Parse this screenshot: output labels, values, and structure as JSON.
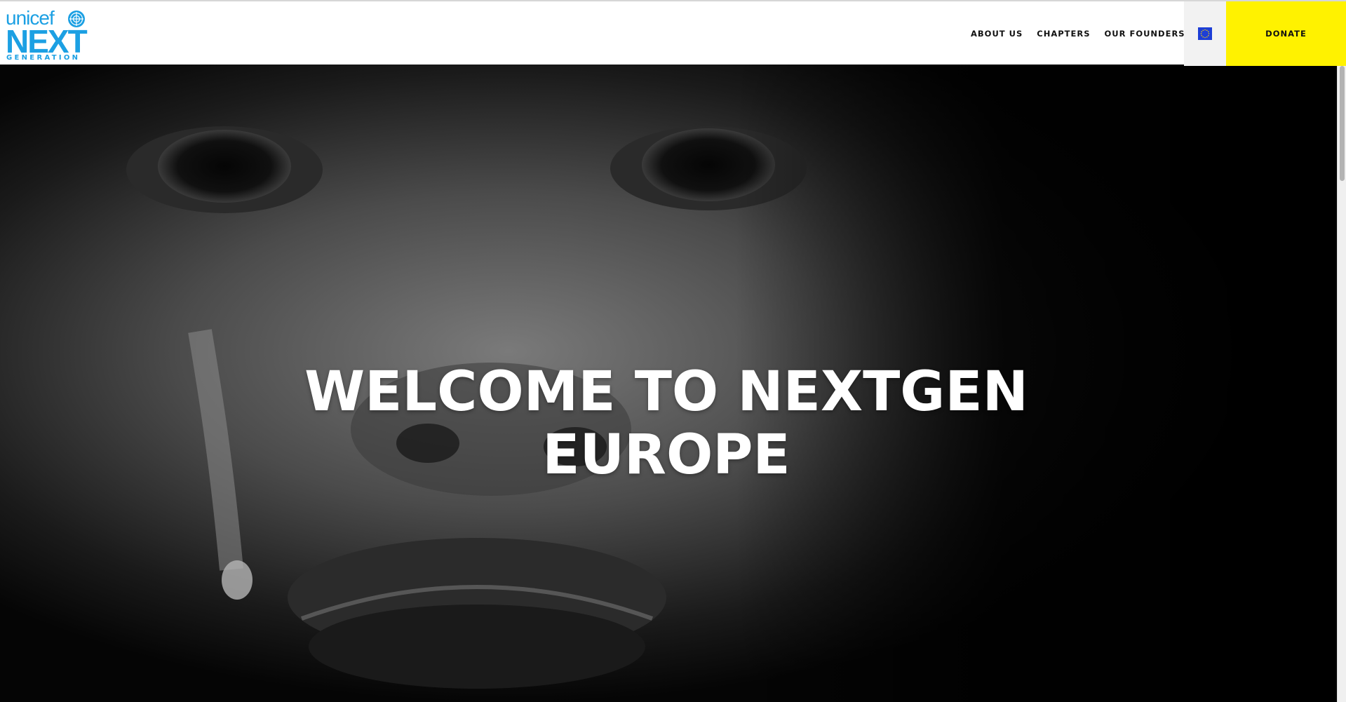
{
  "header": {
    "logo": {
      "top": "unicef",
      "middle": "NEXT",
      "bottom": "GENERATION"
    },
    "nav_items": [
      {
        "label": "ABOUT US"
      },
      {
        "label": "CHAPTERS"
      },
      {
        "label": "OUR FOUNDERS"
      }
    ],
    "language_icon": "eu-flag-icon",
    "donate_label": "DONATE"
  },
  "hero": {
    "title_line1": "WELCOME TO NEXTGEN",
    "title_line2": "EUROPE"
  },
  "colors": {
    "brand_blue": "#1ca0e3",
    "donate_yellow": "#fff200",
    "eu_blue": "#1d3ed6",
    "eu_star": "#ffd700"
  }
}
